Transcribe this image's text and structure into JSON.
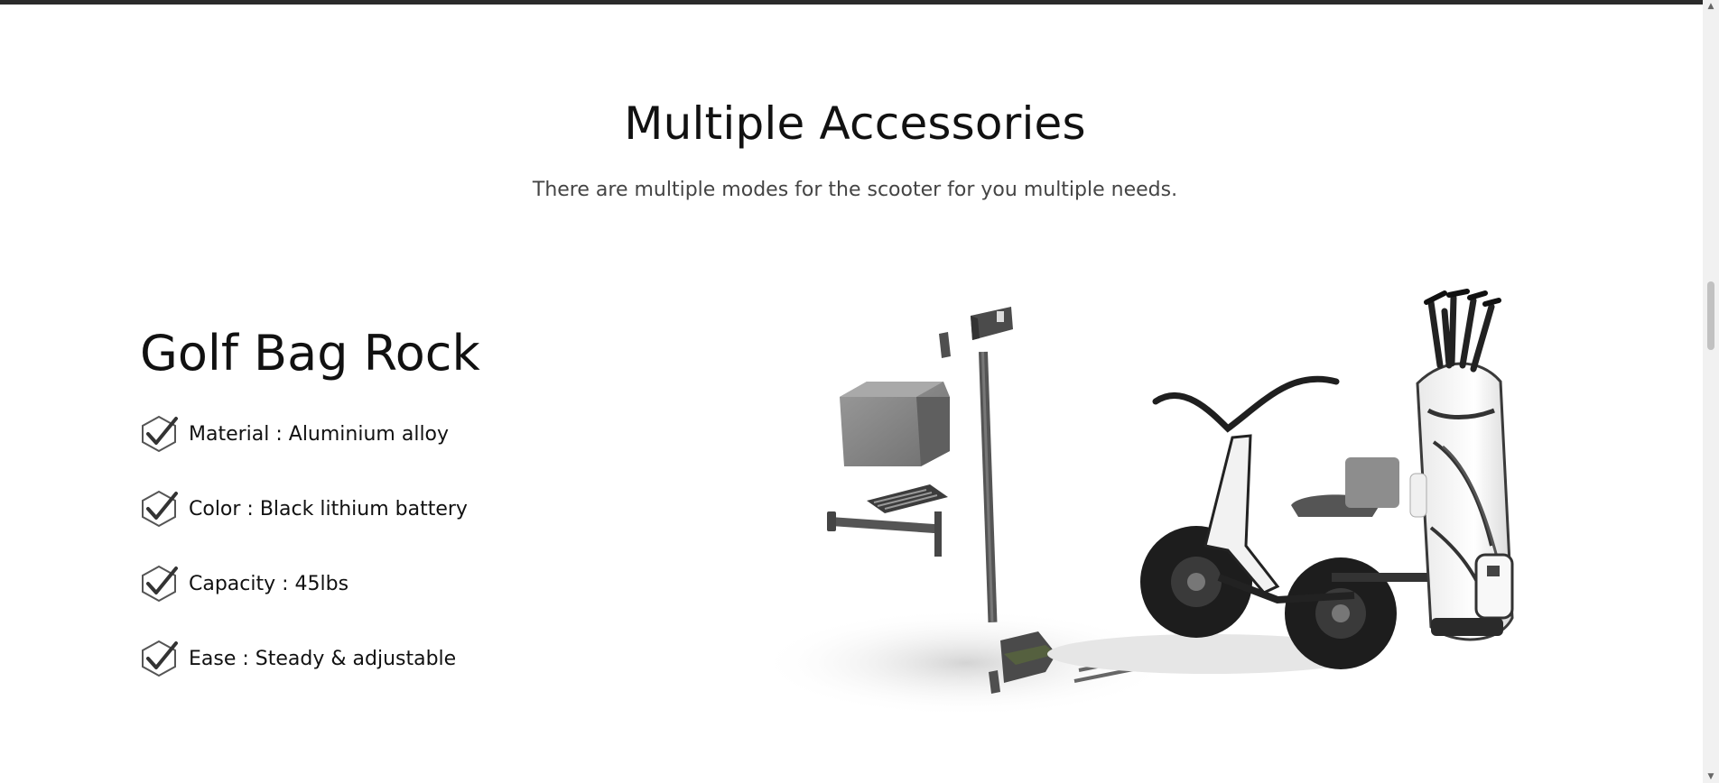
{
  "section": {
    "title": "Multiple Accessories",
    "subtitle": "There are multiple modes for the scooter for you multiple needs."
  },
  "product": {
    "title": "Golf Bag Rock",
    "features": [
      {
        "label": "Material : Aluminium alloy",
        "icon": "checkmark-icon"
      },
      {
        "label": "Color : Black lithium battery",
        "icon": "checkmark-icon"
      },
      {
        "label": "Capacity : 45lbs",
        "icon": "checkmark-icon"
      },
      {
        "label": "Ease : Steady & adjustable",
        "icon": "checkmark-icon"
      }
    ]
  },
  "image": {
    "subject": "exploded-golf-bag-rack-and-scooter"
  },
  "colors": {
    "topbar": "#2b2b2b",
    "text": "#111111",
    "subtitle": "#444444",
    "icon": "#555555"
  },
  "scrollbar": {
    "up_glyph": "▲",
    "down_glyph": "▼"
  }
}
